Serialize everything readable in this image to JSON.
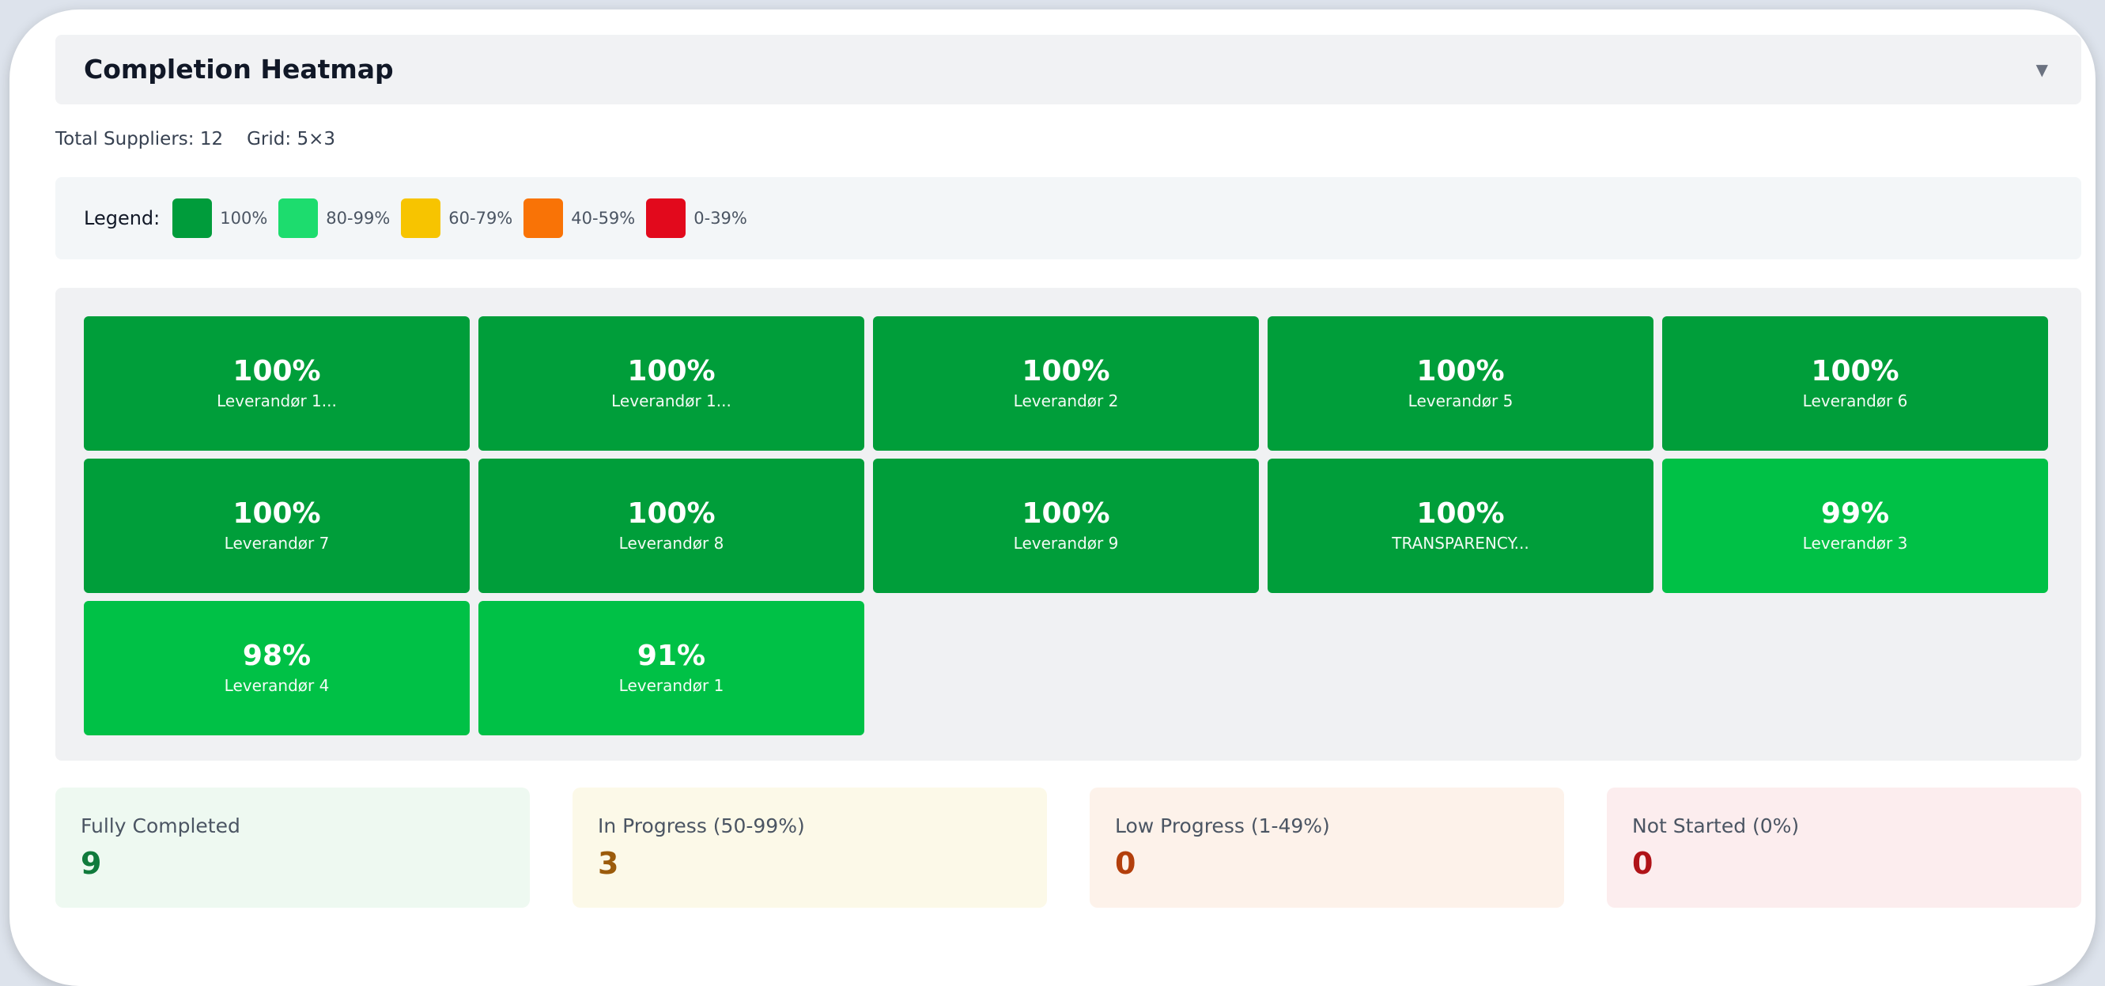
{
  "panel": {
    "title": "Completion Heatmap",
    "toggle_icon": "caret-down-icon",
    "toggle_glyph": "▼"
  },
  "summary": {
    "total_suppliers": "Total Suppliers: 12",
    "grid": "Grid: 5×3"
  },
  "legend": {
    "title": "Legend:",
    "items": [
      {
        "label": "100%",
        "color": "#009c3b"
      },
      {
        "label": "80-99%",
        "color": "#1ddc6e"
      },
      {
        "label": "60-79%",
        "color": "#f7c400"
      },
      {
        "label": "40-59%",
        "color": "#f97306"
      },
      {
        "label": "0-39%",
        "color": "#e2091c"
      }
    ]
  },
  "heatmap": {
    "tiles": [
      {
        "percent": "100%",
        "name": "Leverandør 1...",
        "color": "#009e3a"
      },
      {
        "percent": "100%",
        "name": "Leverandør 1...",
        "color": "#009e3a"
      },
      {
        "percent": "100%",
        "name": "Leverandør 2",
        "color": "#009e3a"
      },
      {
        "percent": "100%",
        "name": "Leverandør 5",
        "color": "#009e3a"
      },
      {
        "percent": "100%",
        "name": "Leverandør 6",
        "color": "#009e3a"
      },
      {
        "percent": "100%",
        "name": "Leverandør 7",
        "color": "#009e3a"
      },
      {
        "percent": "100%",
        "name": "Leverandør 8",
        "color": "#009e3a"
      },
      {
        "percent": "100%",
        "name": "Leverandør 9",
        "color": "#009e3a"
      },
      {
        "percent": "100%",
        "name": "TRANSPARENCY...",
        "color": "#009e3a"
      },
      {
        "percent": "99%",
        "name": "Leverandør 3",
        "color": "#00c146"
      },
      {
        "percent": "98%",
        "name": "Leverandør 4",
        "color": "#00c146"
      },
      {
        "percent": "91%",
        "name": "Leverandør 1",
        "color": "#00c146"
      }
    ]
  },
  "stats": [
    {
      "label": "Fully Completed",
      "value": "9",
      "bg": "#eef9f1",
      "color": "#107a3c"
    },
    {
      "label": "In Progress (50-99%)",
      "value": "3",
      "bg": "#fcf9e8",
      "color": "#9b5b0b"
    },
    {
      "label": "Low Progress (1-49%)",
      "value": "0",
      "bg": "#fdf2ea",
      "color": "#b33f0c"
    },
    {
      "label": "Not Started (0%)",
      "value": "0",
      "bg": "#fcedee",
      "color": "#b01318"
    }
  ]
}
